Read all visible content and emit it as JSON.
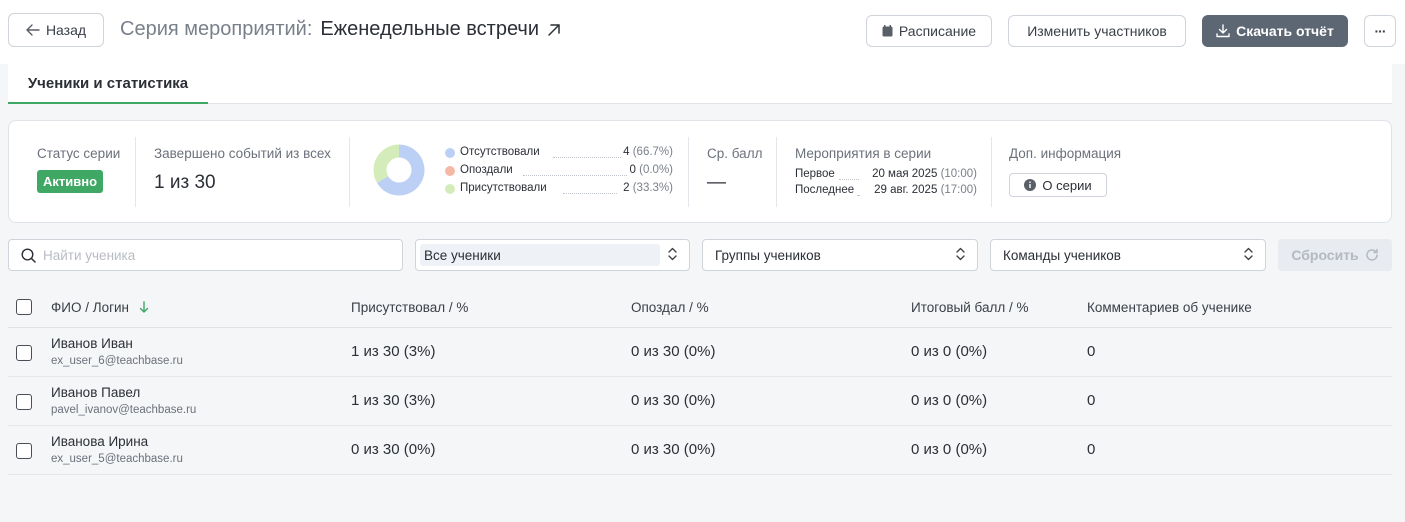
{
  "header": {
    "back_label": "Назад",
    "title_prefix": "Серия мероприятий:",
    "title_name": "Еженедельные встречи",
    "schedule_label": "Расписание",
    "edit_participants_label": "Изменить участников",
    "download_report_label": "Скачать отчёт",
    "more_label": "···"
  },
  "tabs": [
    {
      "label": "Ученики и статистика",
      "active": true
    }
  ],
  "stats": {
    "status_label": "Статус серии",
    "status_value": "Активно",
    "completed_label": "Завершено событий из всех",
    "completed_value": "1 из 30",
    "attendance": [
      {
        "name": "Отсутствовали",
        "count": "4",
        "percent": "(66.7%)",
        "value": 66.7,
        "color": "#bcd0f5"
      },
      {
        "name": "Опоздали",
        "count": "0",
        "percent": "(0.0%)",
        "value": 0.0,
        "color": "#f5b8a4"
      },
      {
        "name": "Присутствовали",
        "count": "2",
        "percent": "(33.3%)",
        "value": 33.3,
        "color": "#d3ecb9"
      }
    ],
    "avg_score_label": "Ср. балл",
    "avg_score_value": "—",
    "events_label": "Мероприятия в серии",
    "first_label": "Первое",
    "first_date": "20 мая 2025",
    "first_time": "(10:00)",
    "last_label": "Последнее",
    "last_date": "29 авг. 2025",
    "last_time": "(17:00)",
    "extra_label": "Доп. информация",
    "about_label": "О серии"
  },
  "filters": {
    "search_placeholder": "Найти ученика",
    "all_students": "Все ученики",
    "groups": "Группы учеников",
    "teams": "Команды учеников",
    "reset_label": "Сбросить"
  },
  "table": {
    "columns": {
      "name": "ФИО / Логин",
      "attended": "Присутствовал / %",
      "late": "Опоздал / %",
      "score": "Итоговый балл / %",
      "comments": "Комментариев об ученике"
    },
    "rows": [
      {
        "name": "Иванов Иван",
        "login": "ex_user_6@teachbase.ru",
        "attended": "1 из 30 (3%)",
        "late": "0 из 30 (0%)",
        "score": "0 из 0 (0%)",
        "comments": "0"
      },
      {
        "name": "Иванов Павел",
        "login": "pavel_ivanov@teachbase.ru",
        "attended": "1 из 30 (3%)",
        "late": "0 из 30 (0%)",
        "score": "0 из 0 (0%)",
        "comments": "0"
      },
      {
        "name": "Иванова Ирина",
        "login": "ex_user_5@teachbase.ru",
        "attended": "0 из 30 (0%)",
        "late": "0 из 30 (0%)",
        "score": "0 из 0 (0%)",
        "comments": "0"
      }
    ]
  },
  "colors": {
    "accent_green": "#3ea864",
    "download_button": "#5d6673"
  }
}
